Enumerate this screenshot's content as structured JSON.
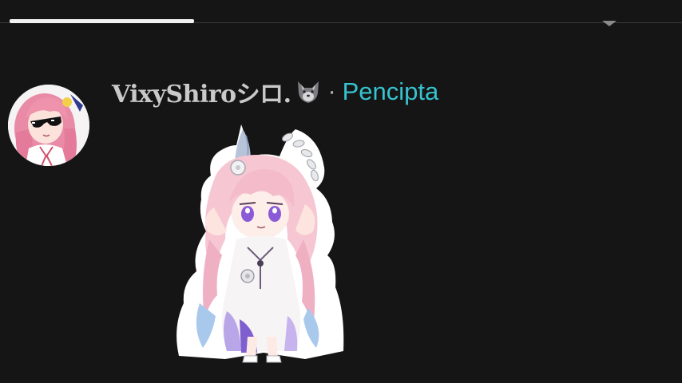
{
  "progress": {
    "fraction": 0.27
  },
  "comment": {
    "username": "VixyShiroシロ.",
    "username_emoji": "wolf-icon",
    "separator": "·",
    "role_badge": "Pencipta",
    "role_color": "#36c3cf"
  },
  "icons": {
    "collapse": "chevron-down-icon",
    "avatar": "avatar",
    "sticker": "anime-chibi-sticker"
  }
}
